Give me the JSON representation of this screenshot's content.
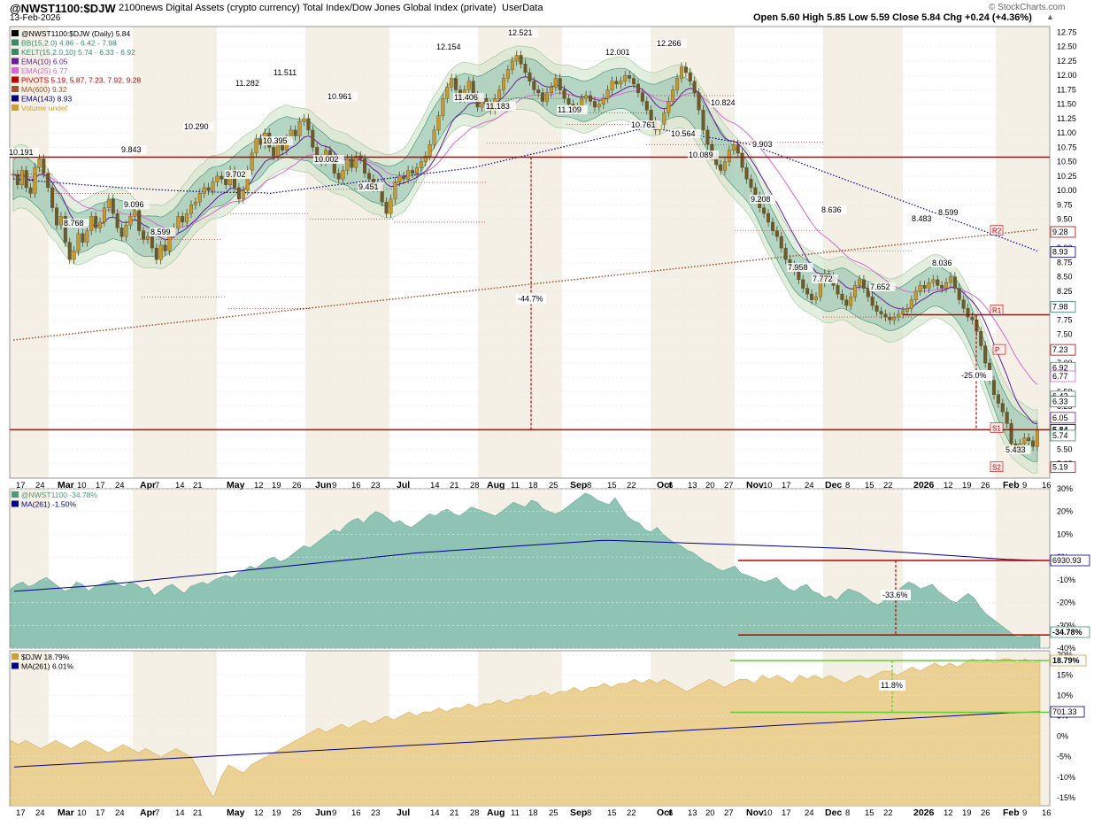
{
  "header": {
    "symbol": "@NWST1100:$DJW",
    "description": "2100news Digital Assets (crypto currency) Total Index/Dow Jones Global Index (private)",
    "tag": "UserData",
    "date": "13-Feb-2026",
    "watermark": "© StockCharts.com",
    "ohlc": "Open 5.60  High 5.85  Low 5.59  Close 5.84  Chg +0.24 (+4.36%)"
  },
  "chart_data": [
    {
      "type": "candlestick",
      "title": "@NWST1100:$DJW (Daily) 5.84",
      "legend": [
        {
          "label": "@NWST1100:$DJW (Daily) 5.84",
          "color": "#000000"
        },
        {
          "label": "BB(15,2.0) 4.86 - 6.42 - 7.98",
          "color": "#3a8a6a"
        },
        {
          "label": "KELT(15,2.0,10) 5.74 - 6.33 - 6.92",
          "color": "#3a8a6a"
        },
        {
          "label": "EMA(10) 6.05",
          "color": "#6a1b9a"
        },
        {
          "label": "EMA(25) 6.77",
          "color": "#d36bd3"
        },
        {
          "label": "PIVOTS 5.19, 5.87, 7.23, 7.92, 9.28",
          "color": "#c00000"
        },
        {
          "label": "MA(600) 9.32",
          "color": "#a0522d"
        },
        {
          "label": "EMA(143) 8.93",
          "color": "#00008b"
        },
        {
          "label": "Volume undef",
          "color": "#c8a040"
        }
      ],
      "ylim": [
        5.0,
        12.85
      ],
      "ticks": [
        "12.75",
        "12.50",
        "12.25",
        "12.00",
        "11.75",
        "11.50",
        "11.25",
        "11.00",
        "10.75",
        "10.50",
        "10.25",
        "10.00",
        "9.75",
        "9.50",
        "9.25",
        "9.00",
        "8.75",
        "8.50",
        "8.25",
        "8.00",
        "7.75",
        "7.50",
        "7.25",
        "7.00",
        "6.75",
        "6.50",
        "6.25",
        "6.00",
        "5.75",
        "5.50",
        "5.25"
      ],
      "close": [
        10.28,
        10.1,
        10.35,
        10.05,
        9.95,
        10.4,
        10.55,
        10.3,
        10.05,
        9.7,
        9.4,
        9.55,
        9.1,
        8.8,
        8.95,
        9.25,
        9.1,
        9.3,
        9.55,
        9.35,
        9.45,
        9.7,
        9.85,
        9.6,
        9.35,
        9.2,
        9.4,
        9.55,
        9.65,
        9.3,
        9.15,
        9.2,
        9.0,
        8.8,
        9.05,
        8.95,
        9.25,
        9.35,
        9.55,
        9.45,
        9.6,
        9.75,
        9.8,
        9.95,
        10.05,
        10.0,
        10.15,
        10.25,
        10.2,
        10.1,
        10.35,
        10.05,
        9.85,
        10.0,
        10.35,
        10.65,
        10.9,
        10.8,
        11.0,
        10.75,
        10.6,
        10.85,
        10.7,
        10.9,
        11.05,
        10.95,
        11.2,
        11.25,
        11.05,
        10.75,
        10.55,
        10.5,
        10.7,
        10.6,
        10.3,
        10.2,
        10.35,
        10.55,
        10.4,
        10.6,
        10.55,
        10.3,
        10.2,
        10.05,
        10.1,
        9.8,
        9.6,
        9.85,
        10.15,
        10.25,
        10.2,
        10.35,
        10.3,
        10.4,
        10.5,
        10.6,
        10.8,
        11.05,
        11.3,
        11.6,
        11.8,
        11.95,
        11.75,
        11.6,
        11.75,
        11.9,
        11.65,
        11.45,
        11.6,
        11.5,
        11.4,
        11.6,
        11.75,
        11.95,
        12.1,
        12.25,
        12.35,
        12.2,
        12.05,
        11.9,
        11.75,
        11.7,
        11.55,
        11.7,
        11.8,
        11.95,
        11.75,
        11.6,
        11.5,
        11.4,
        11.45,
        11.6,
        11.65,
        11.55,
        11.45,
        11.5,
        11.6,
        11.75,
        11.9,
        11.85,
        11.9,
        12.0,
        11.95,
        11.85,
        11.7,
        11.55,
        11.4,
        11.2,
        11.05,
        11.15,
        11.35,
        11.55,
        11.75,
        11.95,
        12.15,
        12.05,
        11.9,
        11.7,
        11.4,
        11.05,
        10.8,
        10.6,
        10.45,
        10.35,
        10.5,
        10.7,
        10.8,
        10.65,
        10.4,
        10.2,
        10.05,
        9.9,
        9.7,
        9.6,
        9.45,
        9.3,
        9.2,
        9.0,
        8.8,
        8.7,
        8.6,
        8.45,
        8.3,
        8.2,
        8.1,
        8.15,
        8.4,
        8.55,
        8.5,
        8.35,
        8.2,
        8.1,
        8.0,
        8.15,
        8.35,
        8.45,
        8.3,
        8.15,
        8.0,
        7.9,
        7.85,
        7.8,
        7.75,
        7.8,
        7.85,
        7.9,
        7.95,
        8.1,
        8.25,
        8.35,
        8.3,
        8.4,
        8.45,
        8.35,
        8.3,
        8.4,
        8.5,
        8.3,
        8.1,
        7.95,
        7.8,
        7.75,
        7.55,
        7.3,
        7.0,
        6.7,
        6.45,
        6.3,
        6.15,
        5.95,
        5.6,
        5.5,
        5.6,
        5.7,
        5.65,
        5.55,
        5.84
      ]
    },
    {
      "type": "area",
      "title": "@NWST1100 -34.78%",
      "legend": [
        {
          "label": "@NWST1100 -34.78%",
          "color": "#4a9a80"
        },
        {
          "label": "MA(261) -1.50%",
          "color": "#00008b"
        }
      ],
      "ylim": [
        -40,
        30
      ],
      "ticks": [
        "30%",
        "20%",
        "10%",
        "0%",
        "-10%",
        "-20%",
        "-30%",
        "-40%"
      ],
      "labels": {
        "ma": "6930.93",
        "last": "-34.78%"
      },
      "values": [
        -14,
        -12,
        -11,
        -13,
        -12,
        -10,
        -9,
        -11,
        -13,
        -15,
        -14,
        -11,
        -12,
        -15,
        -13,
        -12,
        -11,
        -10,
        -12,
        -13,
        -11,
        -12,
        -14,
        -13,
        -17,
        -15,
        -13,
        -12,
        -14,
        -16,
        -13,
        -12,
        -11,
        -12,
        -10,
        -9,
        -8,
        -9,
        -7,
        -6,
        -4,
        -5,
        -3,
        -1,
        0,
        -2,
        -1,
        1,
        3,
        5,
        4,
        6,
        8,
        10,
        12,
        11,
        14,
        16,
        17,
        15,
        18,
        20,
        19,
        17,
        15,
        16,
        14,
        13,
        15,
        17,
        19,
        18,
        20,
        21,
        19,
        18,
        20,
        22,
        21,
        20,
        19,
        18,
        20,
        22,
        24,
        23,
        22,
        25,
        24,
        21,
        20,
        19,
        20,
        22,
        24,
        26,
        28,
        27,
        25,
        24,
        23,
        26,
        22,
        18,
        16,
        15,
        12,
        11,
        13,
        10,
        8,
        6,
        5,
        3,
        2,
        0,
        -2,
        -3,
        -5,
        -6,
        -5,
        -4,
        -7,
        -8,
        -9,
        -10,
        -11,
        -10,
        -9,
        -12,
        -14,
        -15,
        -13,
        -12,
        -15,
        -16,
        -18,
        -17,
        -19,
        -16,
        -14,
        -15,
        -16,
        -18,
        -20,
        -21,
        -19,
        -17,
        -15,
        -13,
        -11,
        -12,
        -14,
        -13,
        -12,
        -15,
        -17,
        -19,
        -20,
        -18,
        -16,
        -18,
        -22,
        -25,
        -27,
        -29,
        -31,
        -33,
        -35,
        -35,
        -34,
        -35,
        -34.78
      ],
      "ma": [
        -15,
        -14.8,
        -14.6,
        -14.4,
        -14.2,
        -14.0,
        -13.8,
        -13.6,
        -13.4,
        -13.2,
        -13.0,
        -12.8,
        -12.6,
        -12.3,
        -12.0,
        -11.7,
        -11.4,
        -11.1,
        -10.8,
        -10.5,
        -10.2,
        -9.9,
        -9.6,
        -9.3,
        -9.0,
        -8.7,
        -8.4,
        -8.1,
        -7.8,
        -7.5,
        -7.2,
        -6.9,
        -6.6,
        -6.3,
        -6.0,
        -5.7,
        -5.4,
        -5.1,
        -4.8,
        -4.5,
        -4.2,
        -3.9,
        -3.6,
        -3.3,
        -3.0,
        -2.7,
        -2.4,
        -2.1,
        -1.8,
        -1.5,
        -1.2,
        -0.9,
        -0.6,
        -0.3,
        0.0,
        0.3,
        0.6,
        0.9,
        1.2,
        1.5,
        1.8,
        2.0,
        2.2,
        2.4,
        2.6,
        2.8,
        3.0,
        3.2,
        3.4,
        3.6,
        3.8,
        4.0,
        4.2,
        4.4,
        4.6,
        4.8,
        5.0,
        5.2,
        5.4,
        5.6,
        5.8,
        6.0,
        6.2,
        6.4,
        6.6,
        6.8,
        7.0,
        7.2,
        7.3,
        7.3,
        7.2,
        7.1,
        7.0,
        6.9,
        6.8,
        6.7,
        6.6,
        6.5,
        6.4,
        6.3,
        6.2,
        6.1,
        6.0,
        5.9,
        5.8,
        5.7,
        5.6,
        5.5,
        5.4,
        5.3,
        5.2,
        5.1,
        5.0,
        4.9,
        4.8,
        4.7,
        4.6,
        4.5,
        4.4,
        4.3,
        4.2,
        4.1,
        4.0,
        3.9,
        3.8,
        3.6,
        3.4,
        3.2,
        3.0,
        2.8,
        2.6,
        2.4,
        2.2,
        2.0,
        1.8,
        1.6,
        1.4,
        1.2,
        1.0,
        0.8,
        0.6,
        0.4,
        0.2,
        0.0,
        -0.2,
        -0.4,
        -0.6,
        -0.8,
        -1.0,
        -1.1,
        -1.2,
        -1.3,
        -1.4,
        -1.5
      ]
    },
    {
      "type": "area",
      "title": "$DJW 18.79%",
      "legend": [
        {
          "label": "$DJW 18.79%",
          "color": "#c8a040"
        },
        {
          "label": "MA(261) 6.01%",
          "color": "#00008b"
        }
      ],
      "ylim": [
        -17,
        21
      ],
      "ticks": [
        "20%",
        "15%",
        "10%",
        "5%",
        "0%",
        "-5%",
        "-10%",
        "-15%"
      ],
      "labels": {
        "ma": "701.33",
        "last": "18.79%"
      },
      "values": [
        -1,
        -2,
        -1,
        -2,
        -3,
        -2,
        -1,
        -2,
        -3,
        -2,
        -1,
        -2,
        -3,
        -4,
        -3,
        -2,
        -3,
        -4,
        -3,
        -4,
        -5,
        -4,
        -3,
        -4,
        -5,
        -8,
        -12,
        -15,
        -10,
        -7,
        -8,
        -9,
        -7,
        -6,
        -5,
        -4,
        -3,
        -2,
        -1,
        0,
        1,
        2,
        1,
        2,
        3,
        2,
        3,
        4,
        3,
        4,
        5,
        4,
        5,
        6,
        5,
        6,
        6,
        7,
        6,
        7,
        7,
        8,
        7,
        8,
        8,
        9,
        8,
        9,
        9,
        10,
        10,
        11,
        10,
        11,
        11,
        12,
        11,
        12,
        12,
        13,
        12,
        13,
        13,
        14,
        13,
        14,
        13,
        14,
        13,
        12,
        11,
        12,
        13,
        14,
        13,
        12,
        13,
        14,
        14,
        13,
        15,
        14,
        15,
        14,
        13,
        15,
        14,
        15,
        14,
        15,
        14,
        13,
        14,
        15,
        14,
        15,
        16,
        16,
        15,
        16,
        17,
        16,
        17,
        18,
        17,
        18,
        17,
        18,
        19,
        18,
        19,
        18,
        19,
        19,
        18,
        19,
        18,
        18.79
      ],
      "ma": [
        -7.5,
        -7.4,
        -7.3,
        -7.2,
        -7.1,
        -7.0,
        -6.9,
        -6.8,
        -6.7,
        -6.6,
        -6.5,
        -6.4,
        -6.3,
        -6.2,
        -6.1,
        -6.0,
        -5.9,
        -5.8,
        -5.7,
        -5.6,
        -5.5,
        -5.4,
        -5.3,
        -5.2,
        -5.1,
        -5.0,
        -4.9,
        -4.8,
        -4.7,
        -4.6,
        -4.5,
        -4.4,
        -4.3,
        -4.2,
        -4.1,
        -4.0,
        -3.9,
        -3.8,
        -3.7,
        -3.6,
        -3.5,
        -3.4,
        -3.3,
        -3.2,
        -3.1,
        -3.0,
        -2.9,
        -2.8,
        -2.7,
        -2.6,
        -2.5,
        -2.4,
        -2.3,
        -2.2,
        -2.1,
        -2.0,
        -1.9,
        -1.8,
        -1.7,
        -1.6,
        -1.5,
        -1.4,
        -1.3,
        -1.2,
        -1.1,
        -1.0,
        -0.9,
        -0.8,
        -0.7,
        -0.6,
        -0.5,
        -0.4,
        -0.3,
        -0.2,
        -0.1,
        0.0,
        0.1,
        0.2,
        0.3,
        0.4,
        0.5,
        0.6,
        0.7,
        0.8,
        0.9,
        1.0,
        1.1,
        1.2,
        1.3,
        1.4,
        1.5,
        1.6,
        1.7,
        1.8,
        1.9,
        2.0,
        2.1,
        2.2,
        2.3,
        2.4,
        2.5,
        2.6,
        2.7,
        2.8,
        2.9,
        3.0,
        3.1,
        3.2,
        3.3,
        3.4,
        3.5,
        3.6,
        3.7,
        3.8,
        3.9,
        4.0,
        4.1,
        4.2,
        4.3,
        4.4,
        4.5,
        4.6,
        4.7,
        4.8,
        4.9,
        5.0,
        5.1,
        5.2,
        5.3,
        5.4,
        5.5,
        5.6,
        5.7,
        5.8,
        5.85,
        5.9,
        5.95,
        6.01
      ]
    }
  ],
  "price_labels": [
    "10.191",
    "8.768",
    "9.843",
    "9.096",
    "8.599",
    "10.290",
    "9.702",
    "11.282",
    "11.511",
    "10.395",
    "10.961",
    "10.002",
    "9.451",
    "12.154",
    "11.406",
    "11.183",
    "12.521",
    "11.109",
    "12.001",
    "10.761",
    "12.266",
    "10.564",
    "10.824",
    "10.089",
    "9.903",
    "9.208",
    "8.636",
    "7.958",
    "7.772",
    "7.652",
    "8.483",
    "8.599",
    "8.036",
    "5.433"
  ],
  "right_labels": [
    "9.28",
    "8.93",
    "7.98",
    "7.23",
    "6.92",
    "6.77",
    "6.42",
    "6.33",
    "6.05",
    "5.84",
    "5.74",
    "5.19"
  ],
  "pivot_tags": [
    "R2",
    "R1",
    "P",
    "S1",
    "S2"
  ],
  "annotations": [
    "-44.7%",
    "-25.0%",
    "-33.6%",
    "11.8%"
  ],
  "months": [
    "17",
    "24",
    "Mar",
    "10",
    "17",
    "24",
    "Apr",
    "7",
    "14",
    "21",
    "May",
    "12",
    "19",
    "26",
    "Jun",
    "9",
    "16",
    "23",
    "Jul",
    "14",
    "21",
    "28",
    "Aug",
    "11",
    "18",
    "25",
    "Sep",
    "8",
    "15",
    "22",
    "Oct",
    "6",
    "13",
    "20",
    "27",
    "Nov",
    "10",
    "17",
    "24",
    "Dec",
    "8",
    "15",
    "22",
    "2026",
    "12",
    "19",
    "26",
    "Feb",
    "9",
    "16"
  ]
}
